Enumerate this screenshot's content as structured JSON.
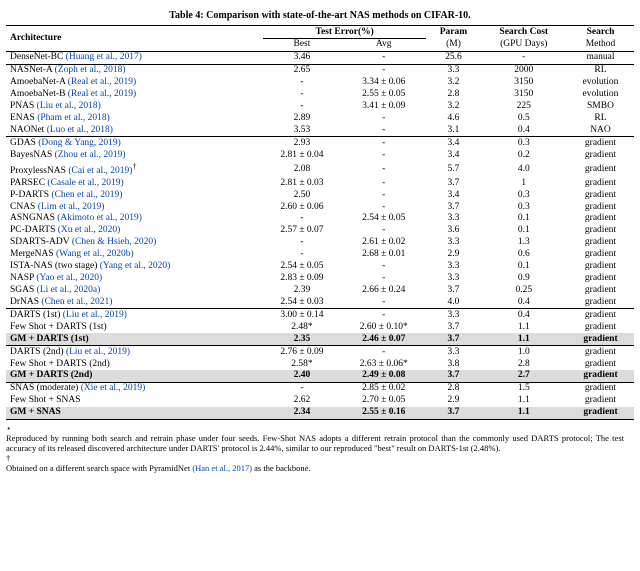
{
  "caption": "Table 4: Comparison with state-of-the-art NAS methods on CIFAR-10.",
  "headers": {
    "arch": "Architecture",
    "test_err": "Test Error(%)",
    "best": "Best",
    "avg": "Avg",
    "param": "Param",
    "param_unit": "(M)",
    "cost": "Search Cost",
    "cost_unit": "(GPU Days)",
    "method": "Search",
    "method2": "Method"
  },
  "chart_data": {
    "type": "table",
    "groups": [
      [
        {
          "arch": "DenseNet-BC",
          "cite": "(Huang et al., 2017)",
          "best": "3.46",
          "avg": "-",
          "param": "25.6",
          "cost": "-",
          "method": "manual"
        }
      ],
      [
        {
          "arch": "NASNet-A",
          "cite": "(Zoph et al., 2018)",
          "best": "2.65",
          "avg": "-",
          "param": "3.3",
          "cost": "2000",
          "method": "RL"
        },
        {
          "arch": "AmoebaNet-A",
          "cite": "(Real et al., 2019)",
          "best": "-",
          "avg": "3.34 ± 0.06",
          "param": "3.2",
          "cost": "3150",
          "method": "evolution"
        },
        {
          "arch": "AmoebaNet-B",
          "cite": "(Real et al., 2019)",
          "best": "-",
          "avg": "2.55 ± 0.05",
          "param": "2.8",
          "cost": "3150",
          "method": "evolution"
        },
        {
          "arch": "PNAS",
          "cite": "(Liu et al., 2018)",
          "best": "-",
          "avg": "3.41 ± 0.09",
          "param": "3.2",
          "cost": "225",
          "method": "SMBO"
        },
        {
          "arch": "ENAS",
          "cite": "(Pham et al., 2018)",
          "best": "2.89",
          "avg": "-",
          "param": "4.6",
          "cost": "0.5",
          "method": "RL"
        },
        {
          "arch": "NAONet",
          "cite": "(Luo et al., 2018)",
          "best": "3.53",
          "avg": "-",
          "param": "3.1",
          "cost": "0.4",
          "method": "NAO"
        }
      ],
      [
        {
          "arch": "GDAS",
          "cite": "(Dong & Yang, 2019)",
          "best": "2.93",
          "avg": "-",
          "param": "3.4",
          "cost": "0.3",
          "method": "gradient"
        },
        {
          "arch": "BayesNAS",
          "cite": "(Zhou et al., 2019)",
          "best": "2.81 ± 0.04",
          "avg": "-",
          "param": "3.4",
          "cost": "0.2",
          "method": "gradient"
        },
        {
          "arch": "ProxylessNAS",
          "cite": "(Cai et al., 2019)",
          "sup": "†",
          "best": "2.08",
          "avg": "-",
          "param": "5.7",
          "cost": "4.0",
          "method": "gradient"
        },
        {
          "arch": "PARSEC",
          "cite": "(Casale et al., 2019)",
          "best": "2.81 ± 0.03",
          "avg": "-",
          "param": "3.7",
          "cost": "1",
          "method": "gradient"
        },
        {
          "arch": "P-DARTS",
          "cite": "(Chen et al., 2019)",
          "best": "2.50",
          "avg": "-",
          "param": "3.4",
          "cost": "0.3",
          "method": "gradient"
        },
        {
          "arch": "CNAS",
          "cite": "(Lim et al., 2019)",
          "best": "2.60 ± 0.06",
          "avg": "-",
          "param": "3.7",
          "cost": "0.3",
          "method": "gradient"
        },
        {
          "arch": "ASNGNAS",
          "cite": "(Akimoto et al., 2019)",
          "best": "-",
          "avg": "2.54 ± 0.05",
          "param": "3.3",
          "cost": "0.1",
          "method": "gradient"
        },
        {
          "arch": "PC-DARTS",
          "cite": "(Xu et al., 2020)",
          "best": "2.57 ± 0.07",
          "avg": "-",
          "param": "3.6",
          "cost": "0.1",
          "method": "gradient"
        },
        {
          "arch": "SDARTS-ADV",
          "cite": "(Chen & Hsieh, 2020)",
          "best": "-",
          "avg": "2.61 ± 0.02",
          "param": "3.3",
          "cost": "1.3",
          "method": "gradient"
        },
        {
          "arch": "MergeNAS",
          "cite": "(Wang et al., 2020b)",
          "best": "-",
          "avg": "2.68 ± 0.01",
          "param": "2.9",
          "cost": "0.6",
          "method": "gradient"
        },
        {
          "arch": "ISTA-NAS (two stage)",
          "cite": "(Yang et al., 2020)",
          "best": "2.54 ± 0.05",
          "avg": "-",
          "param": "3.3",
          "cost": "0.1",
          "method": "gradient"
        },
        {
          "arch": "NASP",
          "cite": "(Yao et al., 2020)",
          "best": "2.83 ± 0.09",
          "avg": "-",
          "param": "3.3",
          "cost": "0.9",
          "method": "gradient"
        },
        {
          "arch": "SGAS",
          "cite": "(Li et al., 2020a)",
          "best": "2.39",
          "avg": "2.66 ± 0.24",
          "param": "3.7",
          "cost": "0.25",
          "method": "gradient"
        },
        {
          "arch": "DrNAS",
          "cite": "(Chen et al., 2021)",
          "best": "2.54 ± 0.03",
          "avg": "-",
          "param": "4.0",
          "cost": "0.4",
          "method": "gradient"
        }
      ],
      [
        {
          "arch": "DARTS (1st)",
          "cite": "(Liu et al., 2019)",
          "best": "3.00 ± 0.14",
          "avg": "-",
          "param": "3.3",
          "cost": "0.4",
          "method": "gradient"
        },
        {
          "arch": "Few Shot + DARTS (1st)",
          "cite": "",
          "best": "2.48*",
          "avg": "2.60 ± 0.10*",
          "param": "3.7",
          "cost": "1.1",
          "method": "gradient"
        },
        {
          "arch": "GM + DARTS (1st)",
          "cite": "",
          "best": "2.35",
          "avg": "2.46 ± 0.07",
          "param": "3.7",
          "cost": "1.1",
          "method": "gradient",
          "hl": true
        }
      ],
      [
        {
          "arch": "DARTS (2nd)",
          "cite": "(Liu et al., 2019)",
          "best": "2.76 ± 0.09",
          "avg": "-",
          "param": "3.3",
          "cost": "1.0",
          "method": "gradient"
        },
        {
          "arch": "Few Shot + DARTS (2nd)",
          "cite": "",
          "best": "2.58*",
          "avg": "2.63 ± 0.06*",
          "param": "3.8",
          "cost": "2.8",
          "method": "gradient"
        },
        {
          "arch": "GM + DARTS (2nd)",
          "cite": "",
          "best": "2.40",
          "avg": "2.49 ± 0.08",
          "param": "3.7",
          "cost": "2.7",
          "method": "gradient",
          "hl": true
        }
      ],
      [
        {
          "arch": "SNAS (moderate)",
          "cite": "(Xie et al., 2019)",
          "best": "-",
          "avg": "2.85 ± 0.02",
          "param": "2.8",
          "cost": "1.5",
          "method": "gradient"
        },
        {
          "arch": "Few Shot + SNAS",
          "cite": "",
          "best": "2.62",
          "avg": "2.70 ± 0.05",
          "param": "2.9",
          "cost": "1.1",
          "method": "gradient"
        },
        {
          "arch": "GM + SNAS",
          "cite": "",
          "best": "2.34",
          "avg": "2.55 ± 0.16",
          "param": "3.7",
          "cost": "1.1",
          "method": "gradient",
          "hl": true
        }
      ]
    ]
  },
  "footnotes": {
    "star_mark": "⋆",
    "star": "Reproduced by running both search and retrain phase under four seeds. Few-Shot NAS adopts a different retrain protocol than the commonly used DARTS protocol; The test accuracy of its released discovered architecture under DARTS' protocol is 2.44%, similar to our reproduced \"best\" result on DARTS-1st (2.48%).",
    "dag_mark": "†",
    "dag": "Obtained on a different search space with PyramidNet (Han et al., 2017) as the backbone.",
    "dag_cite": "(Han et al., 2017)"
  }
}
